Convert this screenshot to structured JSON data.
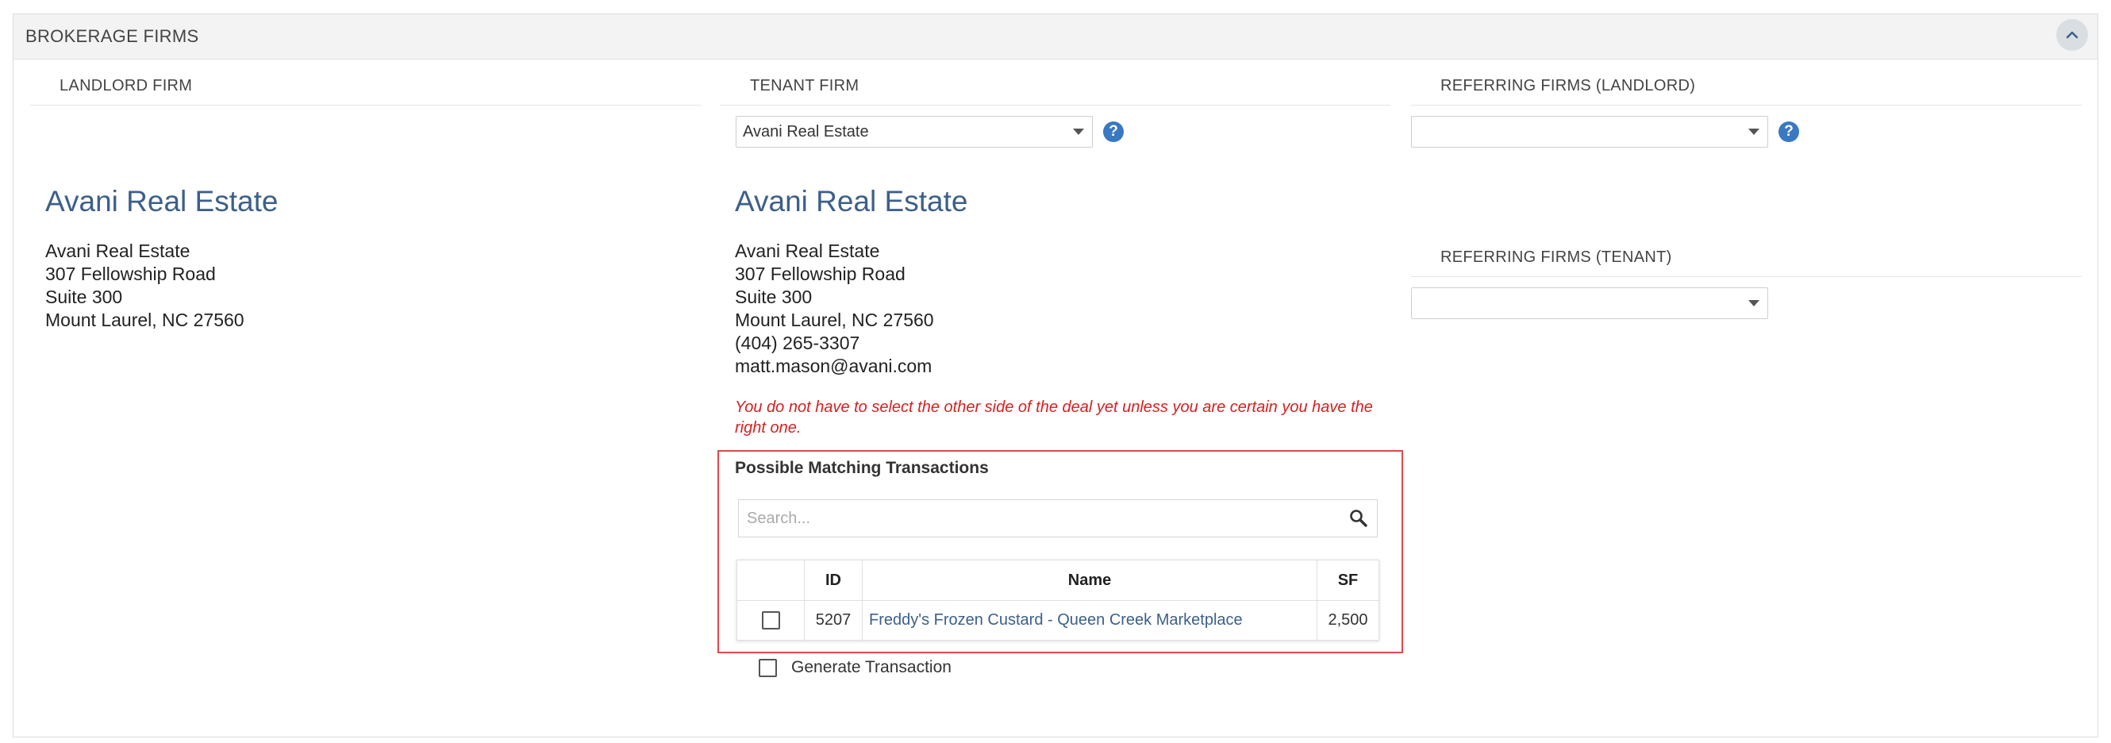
{
  "panel": {
    "title": "BROKERAGE FIRMS"
  },
  "columns": {
    "landlord": {
      "header": "LANDLORD FIRM"
    },
    "tenant": {
      "header": "TENANT FIRM",
      "select_value": "Avani Real Estate"
    },
    "referring_landlord": {
      "header": "REFERRING FIRMS (LANDLORD)",
      "select_value": ""
    },
    "referring_tenant": {
      "header": "REFERRING FIRMS (TENANT)",
      "select_value": ""
    }
  },
  "help_glyph": "?",
  "landlord_firm": {
    "name": "Avani Real Estate",
    "address": [
      "Avani Real Estate",
      "307 Fellowship Road",
      "Suite 300",
      "Mount Laurel, NC 27560"
    ]
  },
  "tenant_firm": {
    "name": "Avani Real Estate",
    "address": [
      "Avani Real Estate",
      "307 Fellowship Road",
      "Suite 300",
      "Mount Laurel, NC 27560",
      "(404) 265-3307",
      "matt.mason@avani.com"
    ]
  },
  "warning": "You do not have to select the other side of the deal yet unless you are certain you have the right one.",
  "matching": {
    "title": "Possible Matching Transactions",
    "search_placeholder": "Search...",
    "columns": [
      "",
      "ID",
      "Name",
      "SF"
    ],
    "rows": [
      {
        "id": "5207",
        "name": "Freddy's Frozen Custard - Queen Creek Marketplace",
        "sf": "2,500"
      }
    ]
  },
  "generate": {
    "label": "Generate Transaction"
  },
  "colors": {
    "accent": "#3d5f8a",
    "warning": "#d62020",
    "highlight_border": "#e0474c",
    "help": "#3a78c2"
  },
  "icons": {
    "collapse": "chevron-up-icon",
    "search": "search-icon",
    "help": "question-circle-icon"
  }
}
